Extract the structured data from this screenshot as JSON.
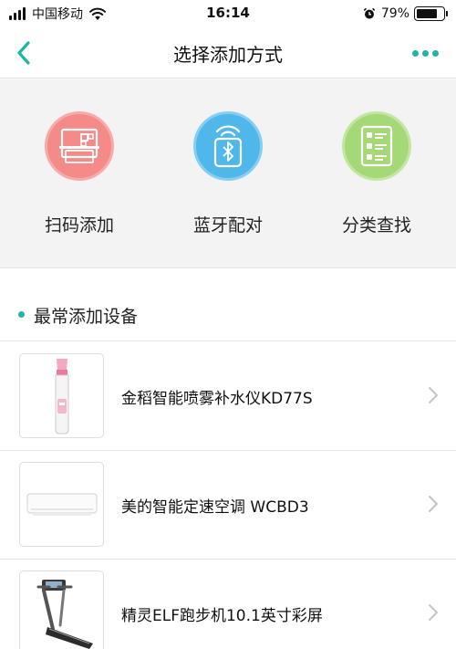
{
  "status_bar": {
    "carrier": "中国移动",
    "time": "16:14",
    "battery_percent": "79%",
    "battery_level": 0.79,
    "icons": [
      "signal-icon",
      "wifi-icon",
      "alarm-icon",
      "battery-icon"
    ]
  },
  "nav": {
    "title": "选择添加方式",
    "back_icon": "back-chevron-icon",
    "more_icon": "more-dots-icon",
    "accent_color": "#1fb4a6"
  },
  "methods": [
    {
      "label": "扫码添加",
      "icon": "scan-qr-icon",
      "color": "#f48b88"
    },
    {
      "label": "蓝牙配对",
      "icon": "bluetooth-icon",
      "color": "#4fb7ea"
    },
    {
      "label": "分类查找",
      "icon": "category-list-icon",
      "color": "#a5d876"
    }
  ],
  "section": {
    "title": "最常添加设备"
  },
  "devices": [
    {
      "name": "金稻智能喷雾补水仪KD77S",
      "image": "facial-mist-sprayer-image"
    },
    {
      "name": "美的智能定速空调 WCBD3",
      "image": "air-conditioner-image"
    },
    {
      "name": "精灵ELF跑步机10.1英寸彩屏",
      "image": "treadmill-image"
    }
  ]
}
